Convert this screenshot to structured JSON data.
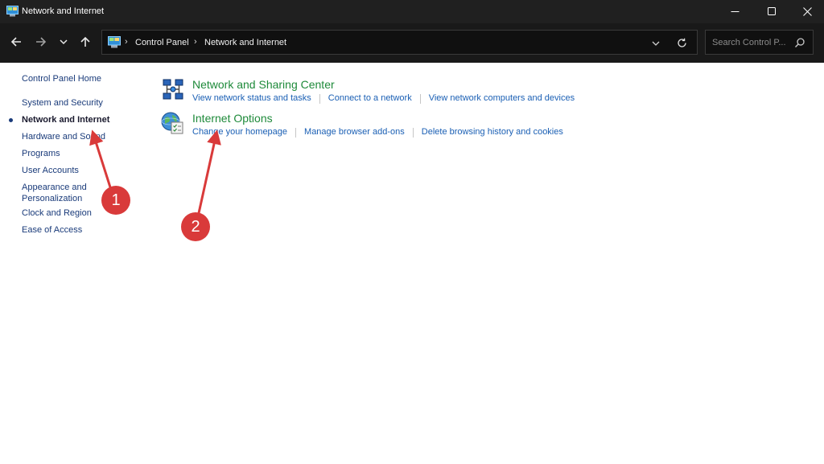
{
  "window": {
    "title": "Network and Internet",
    "icon": "control-panel-icon",
    "controls": [
      "minimize-icon",
      "maximize-icon",
      "close-icon"
    ]
  },
  "navigation": {
    "buttons": [
      "back-arrow-icon",
      "forward-arrow-icon",
      "recent-locations-chevron-icon",
      "up-arrow-icon"
    ],
    "breadcrumb": [
      "Control Panel",
      "Network and Internet"
    ],
    "search": {
      "placeholder": "Search Control P...",
      "value": ""
    }
  },
  "sidebar": {
    "home": "Control Panel Home",
    "items": [
      {
        "label": "System and Security",
        "active": false
      },
      {
        "label": "Network and Internet",
        "active": true
      },
      {
        "label": "Hardware and Sound",
        "active": false
      },
      {
        "label": "Programs",
        "active": false
      },
      {
        "label": "User Accounts",
        "active": false
      },
      {
        "label": "Appearance and Personalization",
        "active": false
      },
      {
        "label": "Clock and Region",
        "active": false
      },
      {
        "label": "Ease of Access",
        "active": false
      }
    ]
  },
  "main": {
    "categories": [
      {
        "icon": "network-sharing-center-icon",
        "title": "Network and Sharing Center",
        "links": [
          "View network status and tasks",
          "Connect to a network",
          "View network computers and devices"
        ]
      },
      {
        "icon": "internet-options-icon",
        "title": "Internet Options",
        "links": [
          "Change your homepage",
          "Manage browser add-ons",
          "Delete browsing history and cookies"
        ]
      }
    ]
  },
  "annotations": [
    {
      "label": "1",
      "points_to": "Network and Internet"
    },
    {
      "label": "2",
      "points_to": "Internet Options"
    }
  ],
  "colors": {
    "titlebar": "#202020",
    "navbar": "#191919",
    "category_title": "#1e8a3a",
    "link": "#1a5fb4",
    "annotation": "#d93a3a"
  }
}
